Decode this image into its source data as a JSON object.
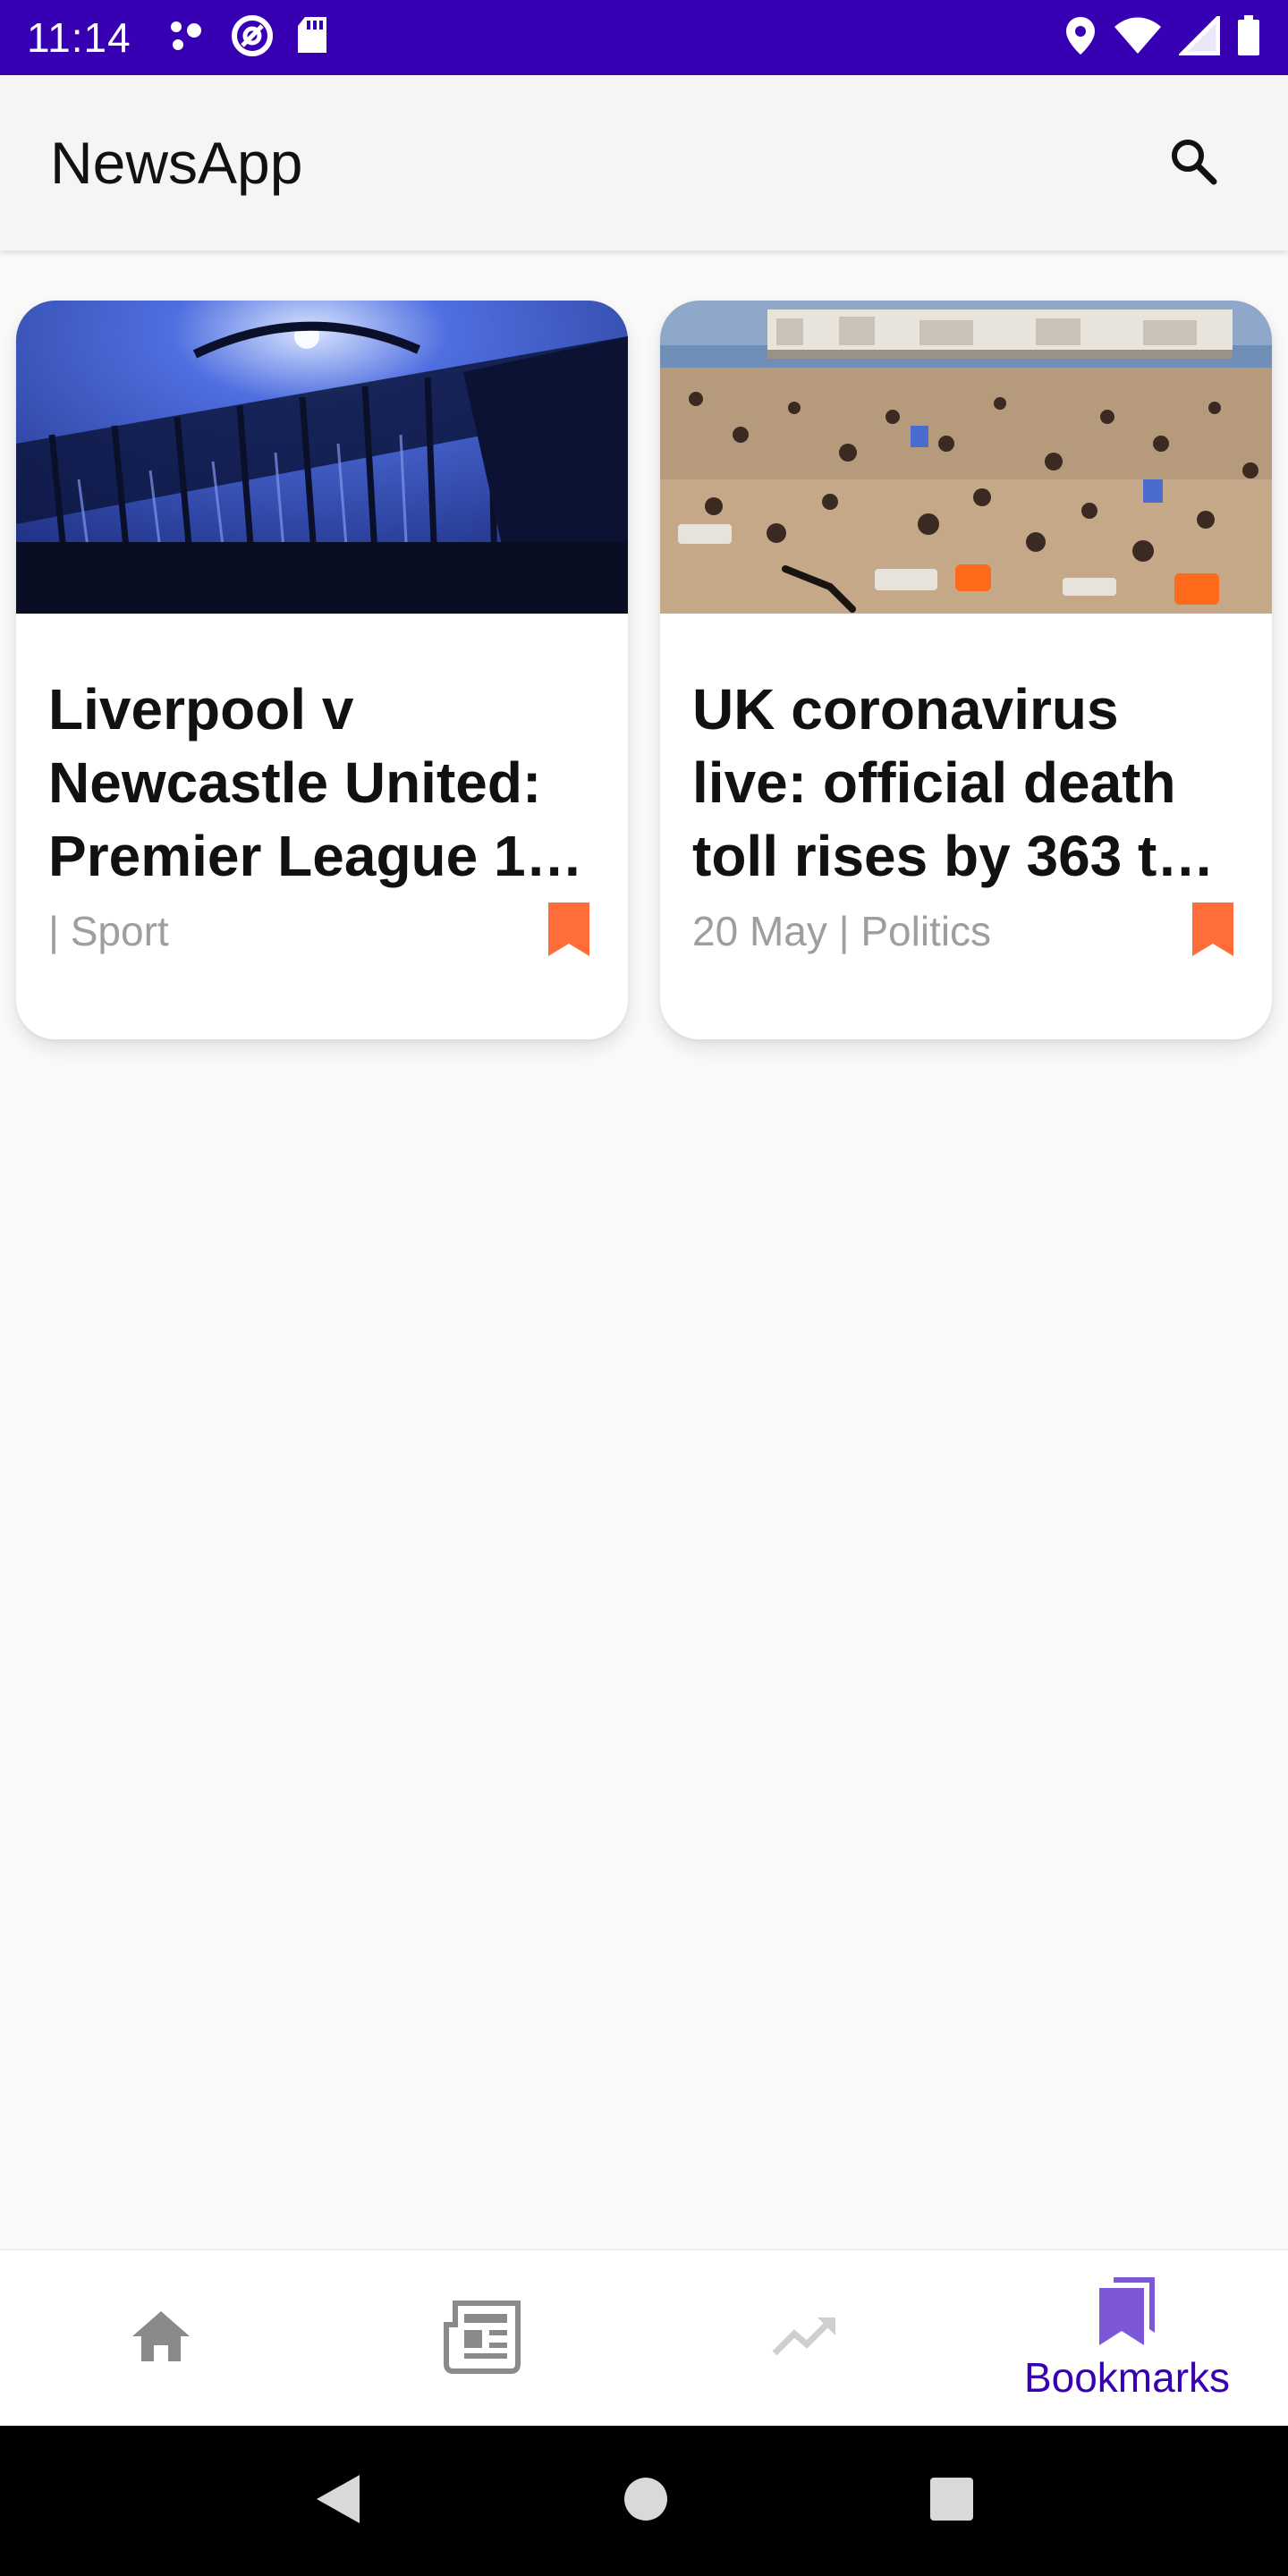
{
  "status_bar": {
    "time": "11:14",
    "left_icons": [
      "dots-icon",
      "at-sign-icon",
      "sd-card-icon"
    ],
    "right_icons": [
      "location-icon",
      "wifi-icon",
      "signal-icon",
      "battery-icon"
    ]
  },
  "app_bar": {
    "title": "NewsApp",
    "search_icon": "search-icon"
  },
  "cards": [
    {
      "title": "Liverpool v Newcastle United: Premier League 1…",
      "meta": " | Sport",
      "image": "stadium-gate-photo",
      "bookmark_icon": "bookmark-filled-icon"
    },
    {
      "title": "UK coronavirus live: official death toll rises by 363 t…",
      "meta": "20 May | Politics",
      "image": "crowded-beach-photo",
      "bookmark_icon": "bookmark-filled-icon"
    }
  ],
  "bottom_nav": {
    "items": [
      {
        "icon": "home-icon",
        "label": ""
      },
      {
        "icon": "newspaper-icon",
        "label": ""
      },
      {
        "icon": "trending-icon",
        "label": ""
      },
      {
        "icon": "bookmarks-icon",
        "label": "Bookmarks",
        "active": true
      }
    ]
  },
  "colors": {
    "status_bar": "#3700b3",
    "accent": "#3700b3",
    "bookmark": "#ff6d3a",
    "inactive_icon": "#8a8a8a"
  }
}
